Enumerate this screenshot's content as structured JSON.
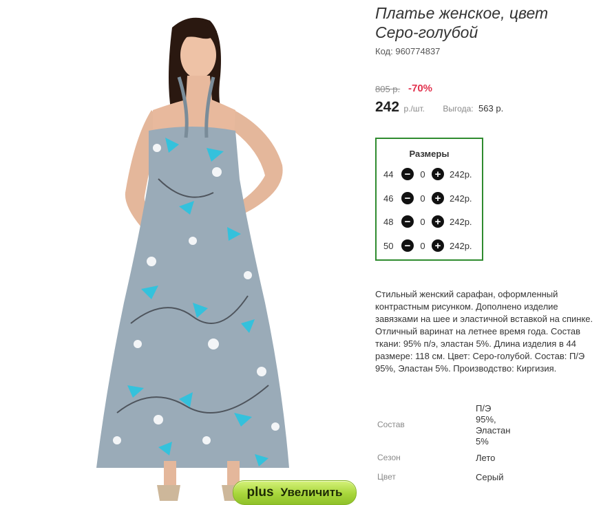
{
  "product": {
    "title": "Платье женское, цвет Серо-голубой",
    "code_label": "Код:",
    "code_value": "960774837",
    "old_price": "805 р.",
    "discount": "-70%",
    "price": "242",
    "unit": "р./шт.",
    "benefit_label": "Выгода:",
    "benefit_value": "563 р."
  },
  "sizes": {
    "title": "Размеры",
    "rows": [
      {
        "size": "44",
        "qty": "0",
        "price": "242р."
      },
      {
        "size": "46",
        "qty": "0",
        "price": "242р."
      },
      {
        "size": "48",
        "qty": "0",
        "price": "242р."
      },
      {
        "size": "50",
        "qty": "0",
        "price": "242р."
      }
    ],
    "minus_icon": "minus-circle-icon",
    "plus_icon": "plus-circle-icon"
  },
  "description": "Стильный женский сарафан, оформленный контрастным рисунком. Дополнено изделие завязками на шее и эластичной вставкой на спинке. Отличный варинат на летнее время года. Состав ткани: 95% п/э, эластан 5%. Длина изделия в 44 размере: 118 см. Цвет: Серо-голубой. Состав: П/Э 95%, Эластан 5%. Производство: Киргизия.",
  "attributes": [
    {
      "label": "Состав",
      "value_lines": [
        "П/Э",
        "95%,",
        "Эластан",
        "5%"
      ]
    },
    {
      "label": "Сезон",
      "value_lines": [
        "Лето"
      ]
    },
    {
      "label": "Цвет",
      "value_lines": [
        "Серый"
      ]
    }
  ],
  "zoom_button": {
    "icon": "plus",
    "label": "Увеличить"
  },
  "colors": {
    "discount": "#e2334f",
    "sizes_border": "#2e8b2e",
    "zoom_button": "#a8d63b",
    "dress": "#9aabb8",
    "print_accent": "#29c4e0"
  }
}
